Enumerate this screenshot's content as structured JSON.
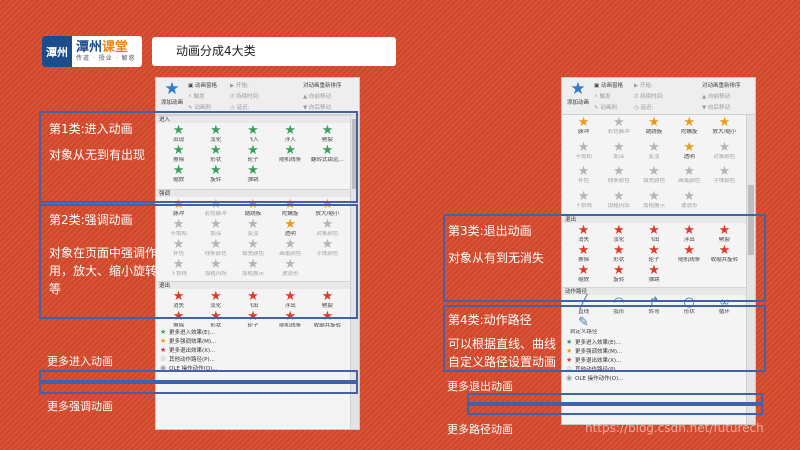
{
  "logo": {
    "mark": "潭州",
    "name_a": "潭州",
    "name_b": "课堂",
    "slogan": "传道 · 授业 · 解惑"
  },
  "title": "动画分成4大类",
  "ribbon": {
    "add_label": "添加动画",
    "pane": "动画窗格",
    "trigger": "触发",
    "painter": "动画刷",
    "start": "开始:",
    "duration": "持续时间:",
    "delay": "延迟:",
    "reorder": "对动画重新排序",
    "forward": "向前移动",
    "backward": "向后移动"
  },
  "colors": {
    "enter": "#3aa05a",
    "emph": "#e89a1c",
    "exit": "#e03a2a",
    "dim": "#b5b5b5",
    "path": "#4b74b0",
    "highlight": "#3f62a8",
    "background": "#d64a2c"
  },
  "sections": {
    "enter": "进入",
    "emph": "强调",
    "exit": "退出",
    "path": "动作路径"
  },
  "enter_items": [
    {
      "label": "出现",
      "icon": "appear-star-icon"
    },
    {
      "label": "淡化",
      "icon": "fade-star-icon"
    },
    {
      "label": "飞入",
      "icon": "fly-in-star-icon"
    },
    {
      "label": "浮入",
      "icon": "float-in-star-icon"
    },
    {
      "label": "劈裂",
      "icon": "split-star-icon"
    },
    {
      "label": "擦除",
      "icon": "wipe-star-icon"
    },
    {
      "label": "形状",
      "icon": "shape-star-icon"
    },
    {
      "label": "轮子",
      "icon": "wheel-star-icon"
    },
    {
      "label": "随机线条",
      "icon": "random-bars-star-icon"
    },
    {
      "label": "翻转式由远...",
      "icon": "grow-turn-star-icon"
    },
    {
      "label": "缩放",
      "icon": "zoom-star-icon"
    },
    {
      "label": "旋转",
      "icon": "swivel-star-icon"
    },
    {
      "label": "弹跳",
      "icon": "bounce-star-icon"
    }
  ],
  "emph_items": [
    {
      "label": "脉冲",
      "dim": false
    },
    {
      "label": "彩色脉冲",
      "dim": true
    },
    {
      "label": "跷跷板",
      "dim": false
    },
    {
      "label": "陀螺旋",
      "dim": false
    },
    {
      "label": "放大/缩小",
      "dim": false
    },
    {
      "label": "不饱和",
      "dim": true
    },
    {
      "label": "加深",
      "dim": true
    },
    {
      "label": "变淡",
      "dim": true
    },
    {
      "label": "透明",
      "dim": false
    },
    {
      "label": "对象颜色",
      "dim": true
    },
    {
      "label": "补色",
      "dim": true
    },
    {
      "label": "线条颜色",
      "dim": true
    },
    {
      "label": "填充颜色",
      "dim": true
    },
    {
      "label": "画笔颜色",
      "dim": true
    },
    {
      "label": "字体颜色",
      "dim": true
    },
    {
      "label": "下划线",
      "dim": true
    },
    {
      "label": "加粗闪烁",
      "dim": true
    },
    {
      "label": "加粗展示",
      "dim": true
    },
    {
      "label": "波浪形",
      "dim": true
    }
  ],
  "exit_items": [
    {
      "label": "消失"
    },
    {
      "label": "淡化"
    },
    {
      "label": "飞出"
    },
    {
      "label": "浮出"
    },
    {
      "label": "劈裂"
    },
    {
      "label": "擦除"
    },
    {
      "label": "形状"
    },
    {
      "label": "轮子"
    },
    {
      "label": "随机线条"
    },
    {
      "label": "收缩并旋转"
    },
    {
      "label": "缩放"
    },
    {
      "label": "旋转"
    },
    {
      "label": "弹跳"
    }
  ],
  "path_items": [
    {
      "label": "直线",
      "icon": "line-path-icon"
    },
    {
      "label": "弧形",
      "icon": "arc-path-icon"
    },
    {
      "label": "转弯",
      "icon": "turn-path-icon"
    },
    {
      "label": "形状",
      "icon": "shape-path-icon"
    },
    {
      "label": "循环",
      "icon": "loop-path-icon"
    },
    {
      "label": "自定义路径",
      "icon": "custom-path-icon"
    }
  ],
  "more_items": [
    {
      "label": "更多进入效果(E)...",
      "icon": "enter-star-icon"
    },
    {
      "label": "更多强调效果(M)...",
      "icon": "emph-star-icon"
    },
    {
      "label": "更多退出效果(X)...",
      "icon": "exit-star-icon"
    },
    {
      "label": "其他动作路径(P)...",
      "icon": "path-star-icon"
    },
    {
      "label": "OLE 操作动作(O)...",
      "icon": "ole-icon"
    }
  ],
  "categories": {
    "cat1_title": "第1类:进入动画",
    "cat1_desc": "对象从无到有出现",
    "cat2_title": "第2类:强调动画",
    "cat2_desc": "对象在页面中强调作用，放大、缩小旋转等",
    "cat3_title": "第3类:退出动画",
    "cat3_desc": "对象从有到无消失",
    "cat4_title": "第4类:动作路径",
    "cat4_desc": "可以根据直线、曲线自定义路径设置动画"
  },
  "more_labels": {
    "enter": "更多进入动画",
    "emph": "更多强调动画",
    "exit": "更多退出动画",
    "path": "更多路径动画"
  },
  "watermark": "https://blog.csdn.net/futurech"
}
